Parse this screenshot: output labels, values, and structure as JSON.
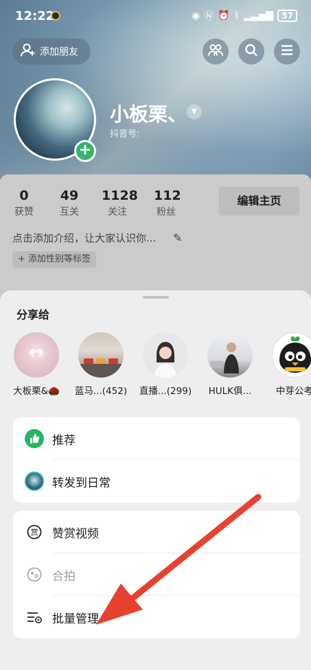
{
  "status_bar": {
    "time": "12:22",
    "battery": "57"
  },
  "header": {
    "add_friend_label": "添加朋友"
  },
  "profile": {
    "nickname": "小板栗、",
    "douyin_id_label": "抖音号:"
  },
  "stats": [
    {
      "value": "0",
      "label": "获赞"
    },
    {
      "value": "49",
      "label": "互关"
    },
    {
      "value": "1128",
      "label": "关注"
    },
    {
      "value": "112",
      "label": "粉丝"
    }
  ],
  "edit_profile_label": "编辑主页",
  "intro_text": "点击添加介绍，让大家认识你...",
  "add_tag_label": "+ 添加性别等标签",
  "share_sheet": {
    "title": "分享给",
    "contacts": [
      {
        "name": "大板栗&🌰"
      },
      {
        "name": "蓝马...(452)"
      },
      {
        "name": "直播...(299)"
      },
      {
        "name": "HULK俱..."
      },
      {
        "name": "中芽公考"
      }
    ],
    "card1": [
      {
        "label": "推荐",
        "icon": "thumbs-up-icon"
      },
      {
        "label": "转发到日常",
        "icon": "daily-avatar-icon"
      }
    ],
    "card2": [
      {
        "label": "赞赏视频",
        "icon": "reward-icon"
      },
      {
        "label": "合拍",
        "icon": "duet-icon"
      },
      {
        "label": "批量管理",
        "icon": "batch-manage-icon"
      }
    ]
  },
  "colors": {
    "recommend_green": "#28b463",
    "annotation_arrow": "#e8412f"
  }
}
